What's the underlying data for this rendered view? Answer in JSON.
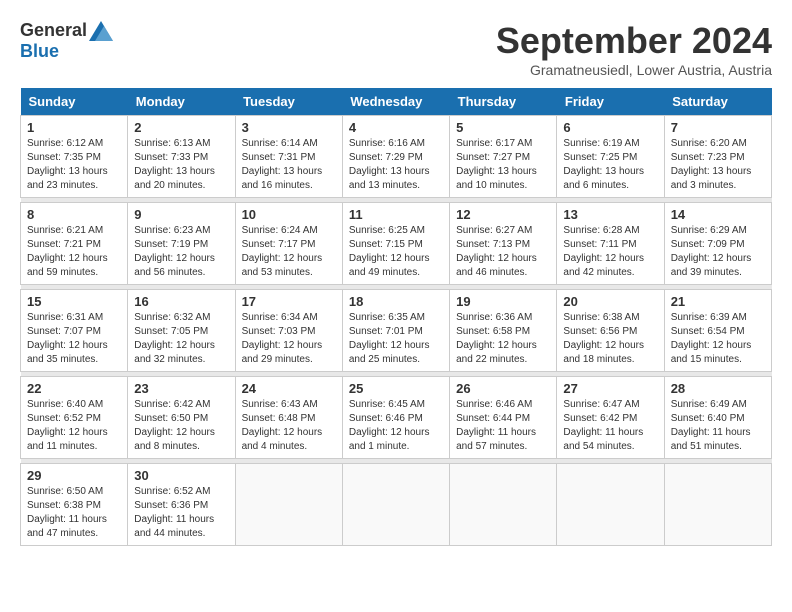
{
  "logo": {
    "general": "General",
    "blue": "Blue"
  },
  "title": "September 2024",
  "location": "Gramatneusiedl, Lower Austria, Austria",
  "days_of_week": [
    "Sunday",
    "Monday",
    "Tuesday",
    "Wednesday",
    "Thursday",
    "Friday",
    "Saturday"
  ],
  "weeks": [
    [
      {
        "day": "1",
        "sunrise": "6:12 AM",
        "sunset": "7:35 PM",
        "daylight": "13 hours and 23 minutes."
      },
      {
        "day": "2",
        "sunrise": "6:13 AM",
        "sunset": "7:33 PM",
        "daylight": "13 hours and 20 minutes."
      },
      {
        "day": "3",
        "sunrise": "6:14 AM",
        "sunset": "7:31 PM",
        "daylight": "13 hours and 16 minutes."
      },
      {
        "day": "4",
        "sunrise": "6:16 AM",
        "sunset": "7:29 PM",
        "daylight": "13 hours and 13 minutes."
      },
      {
        "day": "5",
        "sunrise": "6:17 AM",
        "sunset": "7:27 PM",
        "daylight": "13 hours and 10 minutes."
      },
      {
        "day": "6",
        "sunrise": "6:19 AM",
        "sunset": "7:25 PM",
        "daylight": "13 hours and 6 minutes."
      },
      {
        "day": "7",
        "sunrise": "6:20 AM",
        "sunset": "7:23 PM",
        "daylight": "13 hours and 3 minutes."
      }
    ],
    [
      {
        "day": "8",
        "sunrise": "6:21 AM",
        "sunset": "7:21 PM",
        "daylight": "12 hours and 59 minutes."
      },
      {
        "day": "9",
        "sunrise": "6:23 AM",
        "sunset": "7:19 PM",
        "daylight": "12 hours and 56 minutes."
      },
      {
        "day": "10",
        "sunrise": "6:24 AM",
        "sunset": "7:17 PM",
        "daylight": "12 hours and 53 minutes."
      },
      {
        "day": "11",
        "sunrise": "6:25 AM",
        "sunset": "7:15 PM",
        "daylight": "12 hours and 49 minutes."
      },
      {
        "day": "12",
        "sunrise": "6:27 AM",
        "sunset": "7:13 PM",
        "daylight": "12 hours and 46 minutes."
      },
      {
        "day": "13",
        "sunrise": "6:28 AM",
        "sunset": "7:11 PM",
        "daylight": "12 hours and 42 minutes."
      },
      {
        "day": "14",
        "sunrise": "6:29 AM",
        "sunset": "7:09 PM",
        "daylight": "12 hours and 39 minutes."
      }
    ],
    [
      {
        "day": "15",
        "sunrise": "6:31 AM",
        "sunset": "7:07 PM",
        "daylight": "12 hours and 35 minutes."
      },
      {
        "day": "16",
        "sunrise": "6:32 AM",
        "sunset": "7:05 PM",
        "daylight": "12 hours and 32 minutes."
      },
      {
        "day": "17",
        "sunrise": "6:34 AM",
        "sunset": "7:03 PM",
        "daylight": "12 hours and 29 minutes."
      },
      {
        "day": "18",
        "sunrise": "6:35 AM",
        "sunset": "7:01 PM",
        "daylight": "12 hours and 25 minutes."
      },
      {
        "day": "19",
        "sunrise": "6:36 AM",
        "sunset": "6:58 PM",
        "daylight": "12 hours and 22 minutes."
      },
      {
        "day": "20",
        "sunrise": "6:38 AM",
        "sunset": "6:56 PM",
        "daylight": "12 hours and 18 minutes."
      },
      {
        "day": "21",
        "sunrise": "6:39 AM",
        "sunset": "6:54 PM",
        "daylight": "12 hours and 15 minutes."
      }
    ],
    [
      {
        "day": "22",
        "sunrise": "6:40 AM",
        "sunset": "6:52 PM",
        "daylight": "12 hours and 11 minutes."
      },
      {
        "day": "23",
        "sunrise": "6:42 AM",
        "sunset": "6:50 PM",
        "daylight": "12 hours and 8 minutes."
      },
      {
        "day": "24",
        "sunrise": "6:43 AM",
        "sunset": "6:48 PM",
        "daylight": "12 hours and 4 minutes."
      },
      {
        "day": "25",
        "sunrise": "6:45 AM",
        "sunset": "6:46 PM",
        "daylight": "12 hours and 1 minute."
      },
      {
        "day": "26",
        "sunrise": "6:46 AM",
        "sunset": "6:44 PM",
        "daylight": "11 hours and 57 minutes."
      },
      {
        "day": "27",
        "sunrise": "6:47 AM",
        "sunset": "6:42 PM",
        "daylight": "11 hours and 54 minutes."
      },
      {
        "day": "28",
        "sunrise": "6:49 AM",
        "sunset": "6:40 PM",
        "daylight": "11 hours and 51 minutes."
      }
    ],
    [
      {
        "day": "29",
        "sunrise": "6:50 AM",
        "sunset": "6:38 PM",
        "daylight": "11 hours and 47 minutes."
      },
      {
        "day": "30",
        "sunrise": "6:52 AM",
        "sunset": "6:36 PM",
        "daylight": "11 hours and 44 minutes."
      },
      null,
      null,
      null,
      null,
      null
    ]
  ]
}
